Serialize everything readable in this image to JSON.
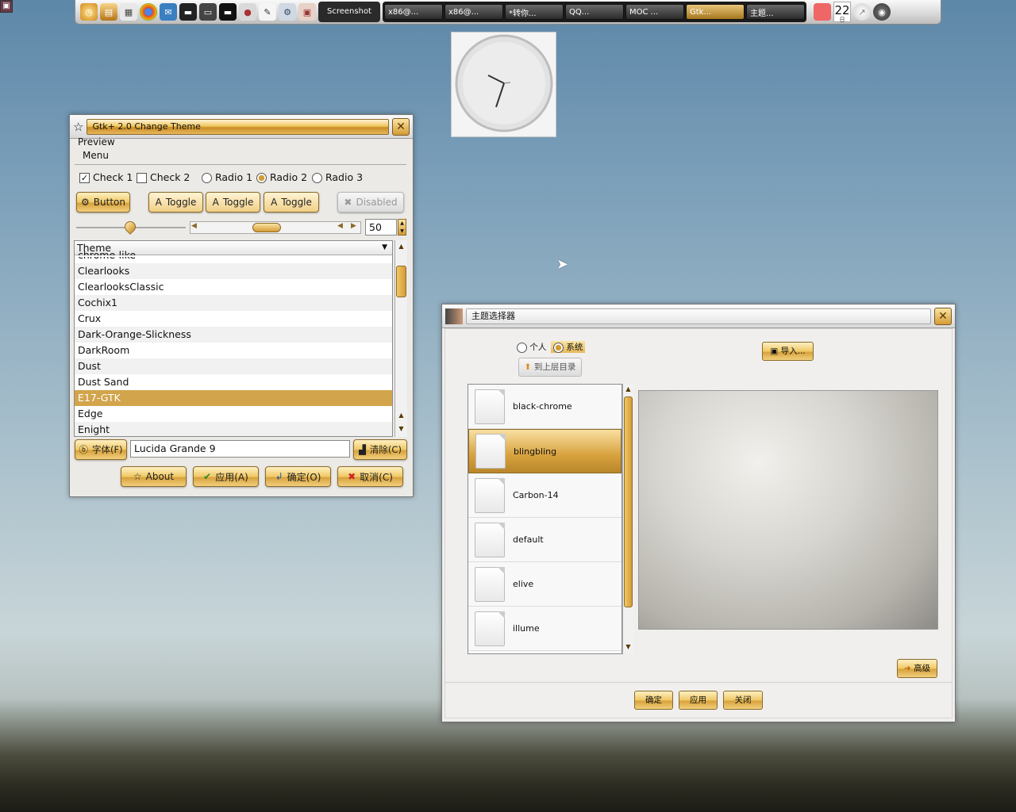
{
  "desktop": {
    "corner_icon": "app-icon"
  },
  "panel": {
    "launchers": [
      "clock-icon",
      "notes-icon",
      "windows-icon",
      "chrome-icon",
      "app-icon",
      "terminal-icon",
      "monitor-icon",
      "display-icon",
      "webcam-icon",
      "editor-icon",
      "settings-icon",
      "screenshot-icon"
    ],
    "screenshot_label": "Screenshot",
    "tasks": [
      "x86@...",
      "x86@...",
      "*转你...",
      "QQ...",
      "MOC ...",
      "Gtk...",
      "主题..."
    ],
    "date_day": "22",
    "date_sub": "日"
  },
  "gtk_window": {
    "title": "Gtk+ 2.0 Change Theme",
    "menu_preview": "Preview",
    "menu_menu": "Menu",
    "check1": "Check 1",
    "check2": "Check 2",
    "radio1": "Radio 1",
    "radio2": "Radio 2",
    "radio3": "Radio 3",
    "button": "Button",
    "toggle1": "Toggle",
    "toggle2": "Toggle",
    "toggle3": "Toggle",
    "disabled": "Disabled",
    "spin_value": "50",
    "list_header": "Theme",
    "themes": [
      "chrome-like",
      "Clearlooks",
      "ClearlooksClassic",
      "Cochix1",
      "Crux",
      "Dark-Orange-Slickness",
      "DarkRoom",
      "Dust",
      "Dust Sand",
      "E17-GTK",
      "Edge",
      "Enight"
    ],
    "selected_theme": "E17-GTK",
    "font_button": "字体(F)",
    "font_value": "Lucida Grande 9",
    "clear_button": "清除(C)",
    "about": "About",
    "apply": "应用(A)",
    "ok": "确定(O)",
    "cancel": "取消(C)"
  },
  "selector_window": {
    "title": "主题选择器",
    "radio_personal": "个人",
    "radio_system": "系统",
    "import": "导入...",
    "up_dir": "到上层目录",
    "themes": [
      "black-chrome",
      "blingbling",
      "Carbon-14",
      "default",
      "elive",
      "illume"
    ],
    "selected": "blingbling",
    "advanced": "高级",
    "ok": "确定",
    "apply": "应用",
    "close": "关闭"
  }
}
